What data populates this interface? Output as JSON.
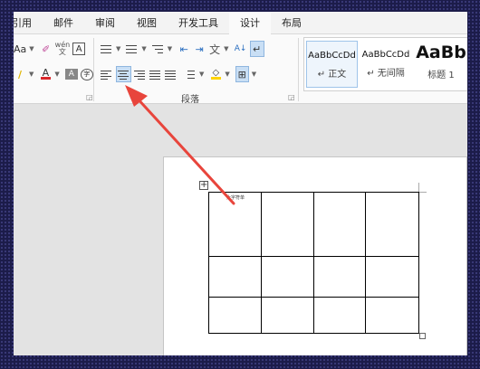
{
  "menubar": {
    "tabs": [
      {
        "label": "引用"
      },
      {
        "label": "邮件"
      },
      {
        "label": "审阅"
      },
      {
        "label": "视图"
      },
      {
        "label": "开发工具"
      },
      {
        "label": "设计",
        "active": true
      },
      {
        "label": "布局"
      }
    ]
  },
  "ribbon": {
    "font_group": {
      "change_case": "Aa",
      "phonetic_top": "wén",
      "phonetic_bottom": "文",
      "char_border": "A",
      "font_color": "A",
      "char_shading": "A",
      "enclose_char": "字"
    },
    "paragraph_group": {
      "label": "段落",
      "sort_icon_text": "A↓",
      "asian_layout_icon_text": "文"
    },
    "styles": [
      {
        "sample": "AaBbCcDd",
        "name": "↵ 正文",
        "active": true
      },
      {
        "sample": "AaBbCcDd",
        "name": "↵ 无间隔",
        "active": false
      },
      {
        "sample": "AaBb",
        "name": "标题 1",
        "active": false
      }
    ]
  },
  "document": {
    "table_move_handle": "+",
    "first_cell_text": "大字符单"
  },
  "colors": {
    "accent_red": "#e8453c",
    "font_color_red": "#d9262a",
    "highlight_yellow": "#ffd400"
  }
}
